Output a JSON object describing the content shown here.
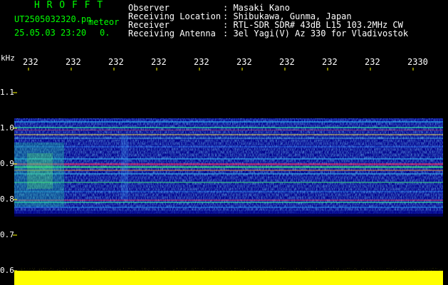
{
  "header": {
    "app_name": "H R O F F T",
    "filename": "UT2505032320.pn",
    "mode": "meteor",
    "datetime": "25.05.03 23:20",
    "count": "0.",
    "labels": [
      "Observer",
      "Receiving Location",
      "Receiver",
      "Receiving Antenna"
    ],
    "values": [
      ": Masaki Kano",
      ": Shibukawa, Gunma, Japan",
      ": RTL-SDR SDR# 43dB L15 103.2MHz CW",
      ": 3el Yagi(V) Az 330 for Vladivostok"
    ]
  },
  "axes": {
    "y_unit": "kHz",
    "y_ticks": [
      "1.1",
      "1.0",
      "0.9",
      "0.8",
      "0.7",
      "0.6"
    ],
    "x_ticks": [
      "232",
      "232",
      "232",
      "232",
      "232",
      "232",
      "232",
      "232",
      "232",
      "2330"
    ]
  },
  "colors": {
    "header_green": "#00ff00",
    "label_white": "#ffffff",
    "tick_yellow": "#ffff00",
    "background_blue": "#00008c",
    "noise_floor": "#ffff00"
  }
}
